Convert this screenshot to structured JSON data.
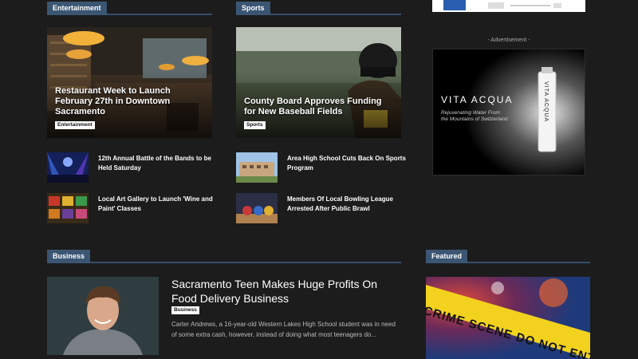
{
  "sections": {
    "entertainment": "Entertainment",
    "sports": "Sports",
    "business": "Business",
    "featured": "Featured"
  },
  "entertainment": {
    "feature": {
      "title": "Restaurant Week to Launch February 27th in Downtown Sacramento",
      "tag": "Entertainment"
    },
    "list": [
      {
        "title": "12th Annual Battle of the Bands to be Held Saturday"
      },
      {
        "title": "Local Art Gallery to Launch 'Wine and Paint' Classes"
      }
    ]
  },
  "sports": {
    "feature": {
      "title": "County Board Approves Funding for New Baseball Fields",
      "tag": "Sports"
    },
    "list": [
      {
        "title": "Area High School Cuts Back On Sports Program"
      },
      {
        "title": "Members Of Local Bowling League Arrested After Public Brawl"
      }
    ]
  },
  "advertisement": {
    "label": "- Advertisement -",
    "brand": "VITA ACQUA",
    "tagline_1": "Rejuvenating Water From",
    "tagline_2": "the Mountains of Switzerland",
    "bottle_text": "VITA ACQUA"
  },
  "business": {
    "title": "Sacramento Teen Makes Huge Profits On Food Delivery Business",
    "tag": "Business",
    "excerpt": "Carter Andrews, a 16-year-old Western Lakes High School student was in need of some extra cash, however, instead of doing what most teenagers do..."
  },
  "featured": {
    "tape_text": "CRIME SCENE DO NOT ENTER"
  },
  "icons": {
    "art": "image-placeholder"
  },
  "colors": {
    "background": "#1c1c1c",
    "section_tab": "#3b5673",
    "section_rule": "#33506e"
  }
}
